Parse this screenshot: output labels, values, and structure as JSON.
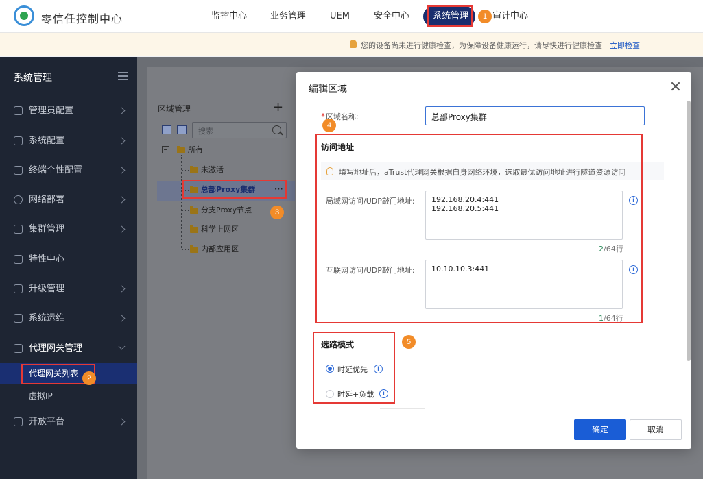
{
  "header": {
    "app_title": "零信任控制中心",
    "nav": [
      "监控中心",
      "业务管理",
      "UEM",
      "安全中心",
      "系统管理",
      "审计中心"
    ],
    "active_nav": "系统管理"
  },
  "notice": {
    "text": "您的设备尚未进行健康检查，为保障设备健康运行，请尽快进行健康检查",
    "link": "立即检查"
  },
  "sidebar": {
    "title": "系统管理",
    "items": [
      {
        "label": "管理员配置",
        "icon": "user-icon"
      },
      {
        "label": "系统配置",
        "icon": "gear-icon"
      },
      {
        "label": "终端个性配置",
        "icon": "monitor-icon"
      },
      {
        "label": "网络部署",
        "icon": "globe-icon"
      },
      {
        "label": "集群管理",
        "icon": "cluster-icon"
      },
      {
        "label": "特性中心",
        "icon": "grid-icon"
      },
      {
        "label": "升级管理",
        "icon": "upload-icon"
      },
      {
        "label": "系统运维",
        "icon": "tools-icon"
      },
      {
        "label": "代理网关管理",
        "icon": "gateway-icon"
      },
      {
        "label": "开放平台",
        "icon": "open-platform-icon"
      }
    ],
    "sub_items": [
      "代理网关列表",
      "虚拟IP"
    ]
  },
  "tree": {
    "title": "区域管理",
    "search_placeholder": "搜索",
    "root": "所有",
    "nodes": [
      "未激活",
      "总部Proxy集群",
      "分支Proxy节点",
      "科学上网区",
      "内部应用区"
    ],
    "more": "···"
  },
  "modal": {
    "title": "编辑区域",
    "name_label": "区域名称:",
    "name_required_mark": "*",
    "name_value": "总部Proxy集群",
    "access_section": "访问地址",
    "hint": "填写地址后，aTrust代理网关根据自身网络环境，选取最优访问地址进行隧道资源访问",
    "lan_label": "局域网访问/UDP敲门地址:",
    "lan_value": "192.168.20.4:441\n192.168.20.5:441",
    "lan_count_used": "2",
    "lan_count_rest": "/64行",
    "wan_label": "互联网访问/UDP敲门地址:",
    "wan_value": "10.10.10.3:441",
    "wan_count_used": "1",
    "wan_count_rest": "/64行",
    "route_section": "选路模式",
    "route_options": [
      "时延优先",
      "时延+负载"
    ],
    "route_selected": "时延优先",
    "ok": "确定",
    "cancel": "取消"
  },
  "steps": [
    "1",
    "2",
    "3",
    "4",
    "5"
  ],
  "colors": {
    "accent": "#1a5dd6",
    "sidebar_bg": "#1e2533",
    "highlight_box": "#e53935",
    "step_badge": "#f28c28"
  }
}
